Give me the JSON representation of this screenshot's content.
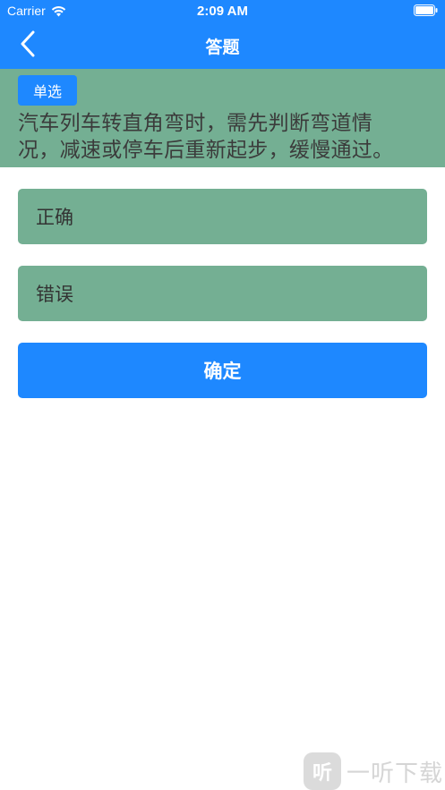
{
  "status_bar": {
    "carrier": "Carrier",
    "time": "2:09 AM",
    "icons": [
      "wifi-icon",
      "battery-icon"
    ]
  },
  "nav": {
    "title": "答题",
    "back_icon": "chevron-left-icon"
  },
  "question": {
    "type_badge": "单选",
    "text": "汽车列车转直角弯时，需先判断弯道情况，减速或停车后重新起步，缓慢通过。"
  },
  "options": [
    {
      "label": "正确"
    },
    {
      "label": "错误"
    }
  ],
  "confirm_label": "确定",
  "watermark": {
    "logo_text": "听",
    "text": "一听下载"
  },
  "colors": {
    "primary": "#1E88FF",
    "option_bg": "#74AF93",
    "background": "#FFFFFF"
  }
}
